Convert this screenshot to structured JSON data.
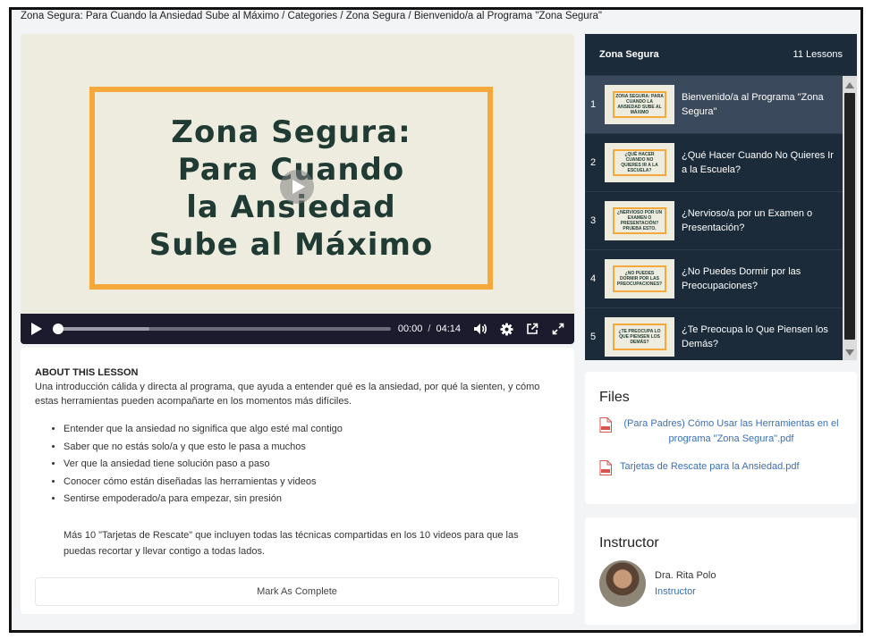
{
  "breadcrumb": "Zona Segura: Para Cuando la Ansiedad Sube al Máximo / Categories / Zona Segura / Bienvenido/a al Programa \"Zona Segura\"",
  "video": {
    "poster_lines": [
      "Zona Segura:",
      "Para Cuando",
      "la Ansiedad",
      "Sube al Máximo"
    ],
    "current_time": "00:00",
    "time_separator": "/",
    "duration": "04:14",
    "played_fraction": 0.0,
    "buffered_fraction": 0.28
  },
  "about": {
    "title": "ABOUT THIS LESSON",
    "description": "Una introducción cálida y directa al programa, que ayuda a entender qué es la ansiedad, por qué la sienten, y cómo estas herramientas pueden acompañarte en los momentos más difíciles.",
    "bullets": [
      "Entender que la ansiedad no significa que algo esté mal contigo",
      "Saber que no estás solo/a y que esto le pasa a muchos",
      "Ver que la ansiedad tiene solución paso a paso",
      "Conocer cómo están diseñadas las herramientas y videos",
      "Sentirse empoderado/a para empezar, sin presión"
    ],
    "extra": "Más 10 \"Tarjetas de Rescate\" que incluyen todas las técnicas compartidas en los 10 videos para que las puedas recortar y llevar contigo a todas lados.",
    "complete_label": "Mark As Complete"
  },
  "lessons": {
    "title": "Zona Segura",
    "count": "11 Lessons",
    "items": [
      {
        "num": "1",
        "title": "Bienvenido/a al Programa \"Zona Segura\"",
        "thumb": "ZONA SEGURA: PARA CUANDO LA ANSIEDAD SUBE AL MÁXIMO",
        "active": true
      },
      {
        "num": "2",
        "title": "¿Qué Hacer Cuando No Quieres Ir a la Escuela?",
        "thumb": "¿QUÉ HACER CUANDO NO QUIERES IR A LA ESCUELA?",
        "active": false
      },
      {
        "num": "3",
        "title": "¿Nervioso/a por un Examen o Presentación?",
        "thumb": "¿NERVIOSO POR UN EXAMEN O PRESENTACIÓN? PRUEBA ESTO.",
        "active": false
      },
      {
        "num": "4",
        "title": "¿No Puedes Dormir por las Preocupaciones?",
        "thumb": "¿NO PUEDES DORMIR POR LAS PREOCUPACIONES?",
        "active": false
      },
      {
        "num": "5",
        "title": "¿Te Preocupa lo Que Piensen los Demás?",
        "thumb": "¿TE PREOCUPA LO QUE PIENSEN LOS DEMÁS?",
        "active": false
      }
    ]
  },
  "files": {
    "title": "Files",
    "items": [
      {
        "name": "(Para Padres) Cómo Usar las Herramientas en el programa \"Zona Segura\".pdf",
        "icon": "pdf-icon"
      },
      {
        "name": "Tarjetas de Rescate para la Ansiedad.pdf",
        "icon": "pdf-icon"
      }
    ]
  },
  "instructor": {
    "title": "Instructor",
    "name": "Dra. Rita Polo",
    "role": "Instructor"
  },
  "colors": {
    "accent_orange": "#f6a93b",
    "poster_text": "#1f3b33",
    "poster_bg": "#eeebdf",
    "lessons_bg": "#1c2b3a",
    "active_lesson_bg": "#3a4a5c",
    "link_blue": "#3b6fb6",
    "controls_bg": "#1b1b2d"
  }
}
